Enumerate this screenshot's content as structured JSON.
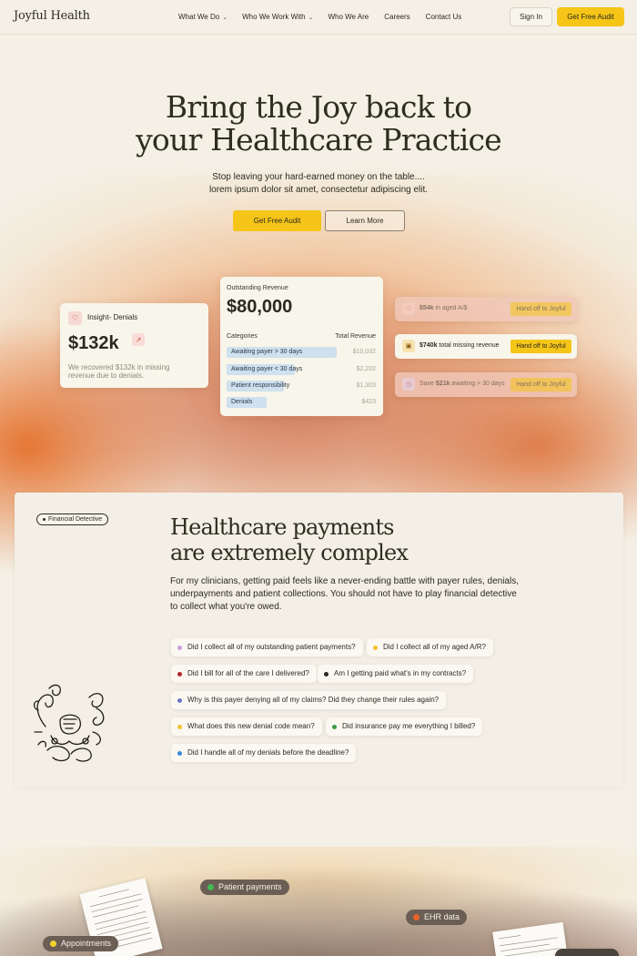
{
  "brand": {
    "logo": "Joyful Health"
  },
  "nav": {
    "links": [
      {
        "label": "What We Do",
        "has_menu": true
      },
      {
        "label": "Who We Work With",
        "has_menu": true
      },
      {
        "label": "Who We Are",
        "has_menu": false
      },
      {
        "label": "Careers",
        "has_menu": false
      },
      {
        "label": "Contact Us",
        "has_menu": false
      }
    ],
    "sign_in": "Sign In",
    "cta": "Get Free Audit"
  },
  "hero": {
    "title_line1": "Bring the Joy back to",
    "title_line2": "your Healthcare Practice",
    "subtitle_line1": "Stop leaving your hard-earned money on the table....",
    "subtitle_line2": "lorem ipsum dolor sit amet, consectetur adipiscing elit.",
    "primary_cta": "Get Free Audit",
    "secondary_cta": "Learn More"
  },
  "denials_card": {
    "title": "Insight- Denials",
    "value": "$132k",
    "description": "We recovered $132k in missing revenue due to denials."
  },
  "revenue_card": {
    "label": "Outstanding Revenue",
    "value": "$80,000",
    "col_categories": "Categories",
    "col_total": "Total Revenue",
    "rows": [
      {
        "label": "Awaiting payer > 30 days",
        "amount": "$10,032",
        "share": 0.97
      },
      {
        "label": "Awaiting payer < 30 days",
        "amount": "$2,202",
        "share": 0.6
      },
      {
        "label": "Patient responsibility",
        "amount": "$1,303",
        "share": 0.5
      },
      {
        "label": "Denials",
        "amount": "$423",
        "share": 0.35
      }
    ]
  },
  "actions": [
    {
      "bold": "$54k",
      "text": " in aged A/$",
      "button": "Hand off to Joyful",
      "icon": "heart-icon",
      "accent": "#f6d2c8"
    },
    {
      "bold": "$740k",
      "text": " total missing revenue",
      "button": "Hand off to Joyful",
      "icon": "money-icon",
      "accent": "#f7e3b0"
    },
    {
      "prefix": "Save ",
      "bold": "$21k",
      "text": " awaiting > 30 days",
      "button": "Hand off to Joyful",
      "icon": "clock-icon",
      "accent": "#e6d4ee"
    }
  ],
  "complex": {
    "badge": "Financial Detective",
    "title_line1": "Healthcare payments",
    "title_line2": "are extremely complex",
    "body": "For my clinicians, getting paid feels like a never-ending battle with payer rules, denials, underpayments and patient collections. You should not have to play financial detective to collect what you're owed.",
    "questions": [
      {
        "text": "Did I collect all of my outstanding patient payments?",
        "color": "#c9a0e0"
      },
      {
        "text": "Did I collect all of my aged A/R?",
        "color": "#f2c12e"
      },
      {
        "text": "Did I bill for all of the care I delivered?",
        "color": "#b3262d"
      },
      {
        "text": "Am I getting paid what's in my contracts?",
        "color": "#2b2a20"
      },
      {
        "text": "Why is this payer denying all of my claims? Did they change their rules again?",
        "color": "#6a78c2"
      },
      {
        "text": "What does this new denial code mean?",
        "color": "#f2c12e"
      },
      {
        "text": "Did insurance pay me everything I billed?",
        "color": "#3a9a46"
      },
      {
        "text": "Did I handle all of my denials before the deadline?",
        "color": "#3b8ad9"
      }
    ]
  },
  "bottom_tags": [
    {
      "label": "Patient payments",
      "color": "#3fb950"
    },
    {
      "label": "EHR data",
      "color": "#e8622c"
    },
    {
      "label": "Appointments",
      "color": "#f2d22e"
    }
  ]
}
